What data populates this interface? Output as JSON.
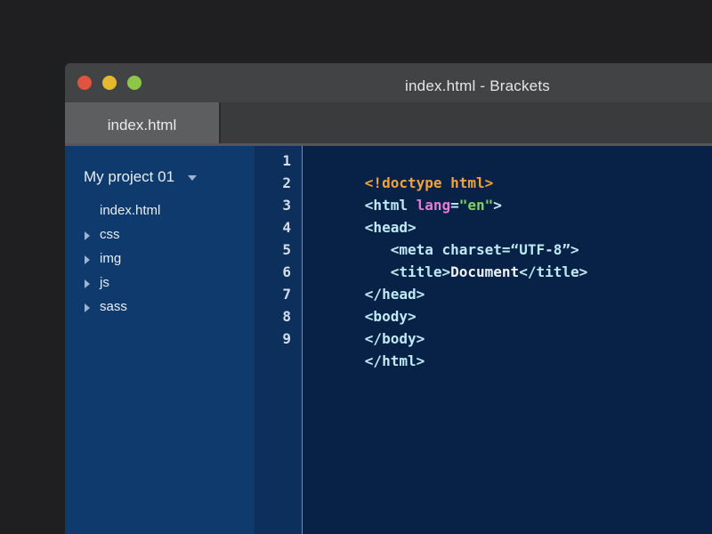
{
  "window": {
    "title": "index.html - Brackets"
  },
  "colors": {
    "close": "#e0533f",
    "minimize": "#e4b92f",
    "zoom": "#8ec64a",
    "sidebar_bg": "#0f3a6e",
    "editor_bg": "#082247",
    "doctype": "#f0a33c",
    "tag": "#bfe9f5",
    "attribute": "#e27cd4",
    "string": "#7fd35b"
  },
  "tabs": [
    {
      "label": "index.html",
      "active": true
    }
  ],
  "sidebar": {
    "project_title": "My project 01",
    "items": [
      {
        "label": "index.html",
        "type": "file"
      },
      {
        "label": "css",
        "type": "folder"
      },
      {
        "label": "img",
        "type": "folder"
      },
      {
        "label": "js",
        "type": "folder"
      },
      {
        "label": "sass",
        "type": "folder"
      }
    ]
  },
  "editor": {
    "line_numbers": [
      "1",
      "2",
      "3",
      "4",
      "5",
      "6",
      "7",
      "8",
      "9"
    ],
    "lines": [
      {
        "tokens": [
          {
            "text": "<!doctype html>",
            "kind": "doctype"
          }
        ]
      },
      {
        "tokens": [
          {
            "text": "<html ",
            "kind": "tag"
          },
          {
            "text": "lang",
            "kind": "attr"
          },
          {
            "text": "=",
            "kind": "eq"
          },
          {
            "text": "\"en\"",
            "kind": "str"
          },
          {
            "text": ">",
            "kind": "tag"
          }
        ]
      },
      {
        "tokens": [
          {
            "text": "<head>",
            "kind": "tag"
          }
        ]
      },
      {
        "tokens": [
          {
            "text": "   <meta charset=“UTF-8”>",
            "kind": "tag"
          }
        ]
      },
      {
        "tokens": [
          {
            "text": "   <title>",
            "kind": "tag"
          },
          {
            "text": "Document",
            "kind": "text"
          },
          {
            "text": "</title>",
            "kind": "tag"
          }
        ]
      },
      {
        "tokens": [
          {
            "text": "</head>",
            "kind": "tag"
          }
        ]
      },
      {
        "tokens": [
          {
            "text": "<body>",
            "kind": "tag"
          }
        ]
      },
      {
        "tokens": [
          {
            "text": "</body>",
            "kind": "tag"
          }
        ]
      },
      {
        "tokens": [
          {
            "text": "</html>",
            "kind": "tag"
          }
        ]
      }
    ]
  }
}
